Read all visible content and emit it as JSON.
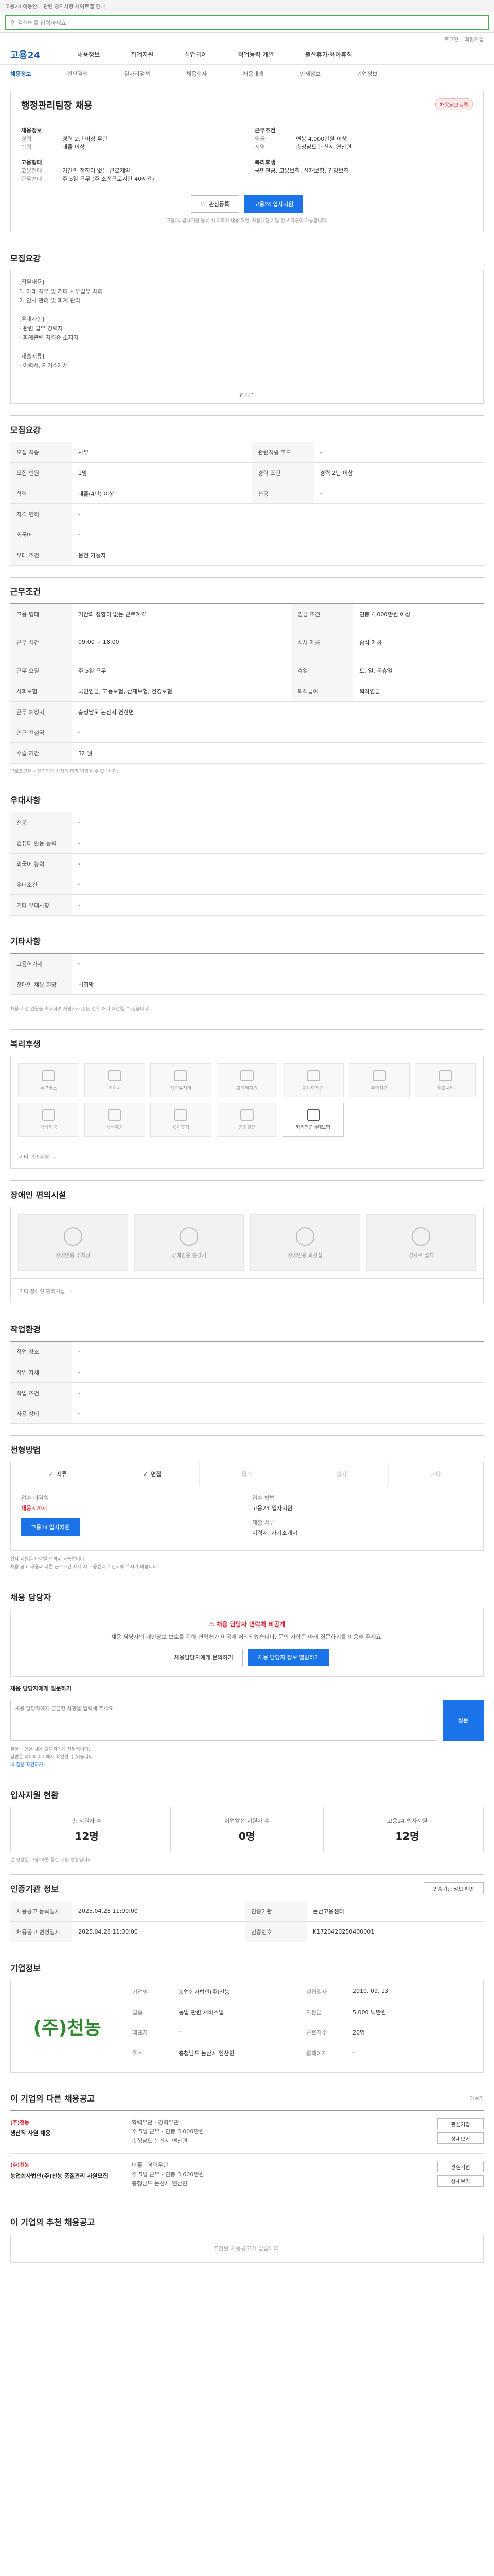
{
  "top_notice": "고용24 이용안내 관련 공지사항 사이트맵 안내",
  "search": {
    "placeholder": "검색어를 입력하세요"
  },
  "login": {
    "login": "로그인",
    "signup": "회원가입"
  },
  "gnb": {
    "logo": "고용24",
    "items": [
      "채용정보",
      "취업지원",
      "실업급여",
      "직업능력 개발",
      "출산휴가·육아휴직"
    ]
  },
  "subnav": [
    "채용정보",
    "간편검색",
    "일자리검색",
    "채용행사",
    "채용대행",
    "인재정보",
    "기업정보"
  ],
  "job": {
    "badge": "채용정보등록",
    "title": "행정관리팀장 채용",
    "left_title": "채용정보",
    "left": [
      {
        "k": "경력",
        "v": "경력 2년 이상 무관"
      },
      {
        "k": "학력",
        "v": "대졸 이상"
      }
    ],
    "right_title": "근무조건",
    "right": [
      {
        "k": "임금",
        "v": "연봉 4,000만원 이상"
      },
      {
        "k": "지역",
        "v": "충청남도 논산시 연산면"
      }
    ],
    "left2_title": "고용형태",
    "left2": [
      {
        "k": "고용형태",
        "v": "기간의 정함이 없는 근로계약"
      },
      {
        "k": "근무형태",
        "v": "주 5일 근무 (주 소정근로시간 40시간)"
      }
    ],
    "right2_title": "복리후생",
    "right2": [
      {
        "k": "",
        "v": "국민연금, 고용보험, 산재보험, 건강보험"
      }
    ],
    "btn_interest": "관심등록",
    "btn_apply": "고용24 입사지원",
    "note": "고용24 입사지원 등록 시 이력서 내용 확인, 채용대행 기업 정보 제공이 가능합니다."
  },
  "desc": {
    "title": "모집요강",
    "lines": [
      "[직무내용]",
      "1. 아래 직무 및 기타 사무업무 처리",
      "2. 인사 관리 및 회계 관리",
      "",
      "[우대사항]",
      "- 관련 업무 경력자",
      "- 회계관련 자격증 소지자",
      "",
      "[제출서류]",
      "- 이력서, 자기소개서"
    ],
    "collapse": "접기"
  },
  "recruit": {
    "title": "모집요강",
    "rows": [
      {
        "k": "모집 직종",
        "v": "사무",
        "k2": "관련직종 코드",
        "v2": "-"
      },
      {
        "k": "모집 인원",
        "v": "1명",
        "k2": "경력 조건",
        "v2": "경력 2년 이상"
      },
      {
        "k": "학력",
        "v": "대졸(4년) 이상",
        "k2": "전공",
        "v2": "-"
      },
      {
        "k": "자격 면허",
        "v": "-",
        "k2": "",
        "v2": ""
      },
      {
        "k": "외국어",
        "v": "-",
        "k2": "",
        "v2": ""
      },
      {
        "k": "우대 조건",
        "v": "운전 가능자",
        "k2": "",
        "v2": ""
      }
    ]
  },
  "work": {
    "title": "근무조건",
    "rows": [
      {
        "k": "고용 형태",
        "v": "기간의 정함이 없는 근로계약",
        "k2": "임금 조건",
        "v2": "연봉 4,000만원 이상"
      },
      {
        "k": "근무 시간",
        "v": "09:00 ~ 18:00",
        "k2": "식사 제공",
        "v2": "중식 제공"
      },
      {
        "k": "근무 요일",
        "v": "주 5일 근무",
        "k2": "휴일",
        "v2": "토, 일, 공휴일"
      },
      {
        "k": "사회보험",
        "v": "국민연금, 고용보험, 산재보험, 건강보험",
        "k2": "퇴직급여",
        "v2": "퇴직연금"
      },
      {
        "k": "근무 예정지",
        "v": "충청남도 논산시 연산면",
        "k2": "",
        "v2": ""
      },
      {
        "k": "인근 전철역",
        "v": "-",
        "k2": "",
        "v2": ""
      },
      {
        "k": "수습 기간",
        "v": "3개월",
        "k2": "",
        "v2": ""
      }
    ],
    "note": "근로조건은 채용기업의 사정에 따라 변경될 수 있습니다."
  },
  "prefer": {
    "title": "우대사항",
    "rows": [
      {
        "k": "전공",
        "v": "-"
      },
      {
        "k": "컴퓨터 활용 능력",
        "v": "-"
      },
      {
        "k": "외국어 능력",
        "v": "-"
      },
      {
        "k": "우대조건",
        "v": "-"
      },
      {
        "k": "기타 우대사항",
        "v": "-"
      }
    ]
  },
  "etc": {
    "title": "기타사항",
    "rows": [
      {
        "k": "고용허가제",
        "v": "-"
      },
      {
        "k": "장애인 채용 희망",
        "v": "비희망"
      }
    ],
    "note": "채용 예정 인원을 초과하여 지원자가 있는 경우 조기 마감될 수 있습니다."
  },
  "welfare": {
    "title": "복리후생",
    "items": [
      {
        "name": "통근버스",
        "on": false
      },
      {
        "name": "기숙사",
        "on": false
      },
      {
        "name": "차량유지비",
        "on": false
      },
      {
        "name": "교육비지원",
        "on": false
      },
      {
        "name": "자녀학자금",
        "on": false
      },
      {
        "name": "주택자금",
        "on": false
      },
      {
        "name": "경조사비",
        "on": false
      },
      {
        "name": "중식제공",
        "on": false
      },
      {
        "name": "석식제공",
        "on": false
      },
      {
        "name": "육아휴직",
        "on": false
      },
      {
        "name": "건강검진",
        "on": false
      },
      {
        "name": "퇴직연금 4대보험",
        "on": true
      }
    ],
    "etc_label": "기타 복리후생",
    "etc_value": "-"
  },
  "disability": {
    "title": "장애인 편의시설",
    "items": [
      "장애인용 주차장",
      "장애인용 승강기",
      "장애인용 화장실",
      "경사로 설치"
    ],
    "etc_label": "기타 장애인 편의시설",
    "etc_value": "-"
  },
  "env": {
    "title": "작업환경",
    "rows": [
      {
        "k": "작업 장소",
        "v": "-",
        "k2": "",
        "v2": ""
      },
      {
        "k": "작업 자세",
        "v": "-",
        "k2": "",
        "v2": ""
      },
      {
        "k": "작업 조건",
        "v": "-",
        "k2": "",
        "v2": ""
      },
      {
        "k": "사용 장비",
        "v": "-",
        "k2": "",
        "v2": ""
      }
    ]
  },
  "process": {
    "title": "전형방법",
    "steps": [
      {
        "name": "서류",
        "on": true
      },
      {
        "name": "면접",
        "on": true
      },
      {
        "name": "필기",
        "on": false
      },
      {
        "name": "실기",
        "on": false
      },
      {
        "name": "기타",
        "on": false
      }
    ],
    "deadline_label": "접수 마감일",
    "deadline": "채용시까지",
    "method_label": "접수 방법",
    "method": "고용24 입사지원",
    "doc_label": "제출 서류",
    "doc": "이력서, 자기소개서",
    "apply_btn": "고용24 입사지원",
    "notes": [
      "입사 지원은 마감일 전까지 가능합니다.",
      "채용 공고 내용과 다른 근로조건 제시 시 고용센터로 신고해 주시기 바랍니다."
    ]
  },
  "contact": {
    "title": "채용 담당자",
    "warn": "채용 담당자 연락처 비공개",
    "desc": "채용 담당자의 개인정보 보호를 위해 연락처가 비공개 처리되었습니다. 문의 사항은 아래 질문하기를 이용해 주세요.",
    "btn1": "채용담당자에게 문의하기",
    "btn2": "채용 담당자 정보 열람하기",
    "qna_title": "채용 담당자에게 질문하기",
    "qna_placeholder": "채용 담당자에게 궁금한 사항을 입력해 주세요.",
    "qna_btn": "질문",
    "qna_notes": [
      "질문 내용은 채용 담당자에게 전달됩니다.",
      "답변은 마이페이지에서 확인할 수 있습니다."
    ],
    "qna_link": "내 질문 확인하기"
  },
  "stats": {
    "title": "입사지원 현황",
    "items": [
      {
        "label": "총 지원자 수",
        "n": "12명"
      },
      {
        "label": "취업알선 지원자 수",
        "n": "0명"
      },
      {
        "label": "고용24 입사지원",
        "n": "12명"
      }
    ],
    "note": "본 현황은 고용24를 통한 지원 현황입니다."
  },
  "reginfo": {
    "title": "인증기관 정보",
    "btn": "인증기관 정보 확인",
    "rows": [
      {
        "k": "채용공고 등록일시",
        "v": "2025.04.28 11:00:00",
        "k2": "인증기관",
        "v2": "논산고용센터"
      },
      {
        "k": "채용공고 변경일시",
        "v": "2025.04.28 11:00:00",
        "k2": "인증번호",
        "v2": "K1720420250400001"
      }
    ]
  },
  "company": {
    "title": "기업정보",
    "logo_text": "(주)천농",
    "rows": [
      {
        "k": "기업명",
        "v": "농업회사법인(주)천농",
        "k2": "설립일자",
        "v2": "2010. 09. 13"
      },
      {
        "k": "업종",
        "v": "농업 관련 서비스업",
        "k2": "자본금",
        "v2": "5,000 백만원"
      },
      {
        "k": "대표자",
        "v": "-",
        "k2": "근로자수",
        "v2": "20명"
      },
      {
        "k": "주소",
        "v": "충청남도 논산시 연산면",
        "k2": "홈페이지",
        "v2": "-"
      }
    ]
  },
  "related": {
    "title": "이 기업의 다른 채용공고",
    "more": "더보기",
    "items": [
      {
        "corp": "(주)천농",
        "title": "생산직 사원 채용",
        "meta": [
          "학력무관 · 경력무관",
          "주 5일 근무 · 연봉 3,000만원",
          "충청남도 논산시 연산면"
        ],
        "b1": "관심기업",
        "b2": "상세보기"
      },
      {
        "corp": "(주)천농",
        "title": "농업회사법인(주)천농 품질관리 사원모집",
        "meta": [
          "대졸 · 경력무관",
          "주 5일 근무 · 연봉 3,600만원",
          "충청남도 논산시 연산면"
        ],
        "b1": "관심기업",
        "b2": "상세보기"
      }
    ]
  },
  "recent": {
    "title": "이 기업의 추천 채용공고",
    "empty": "추천된 채용공고가 없습니다."
  }
}
